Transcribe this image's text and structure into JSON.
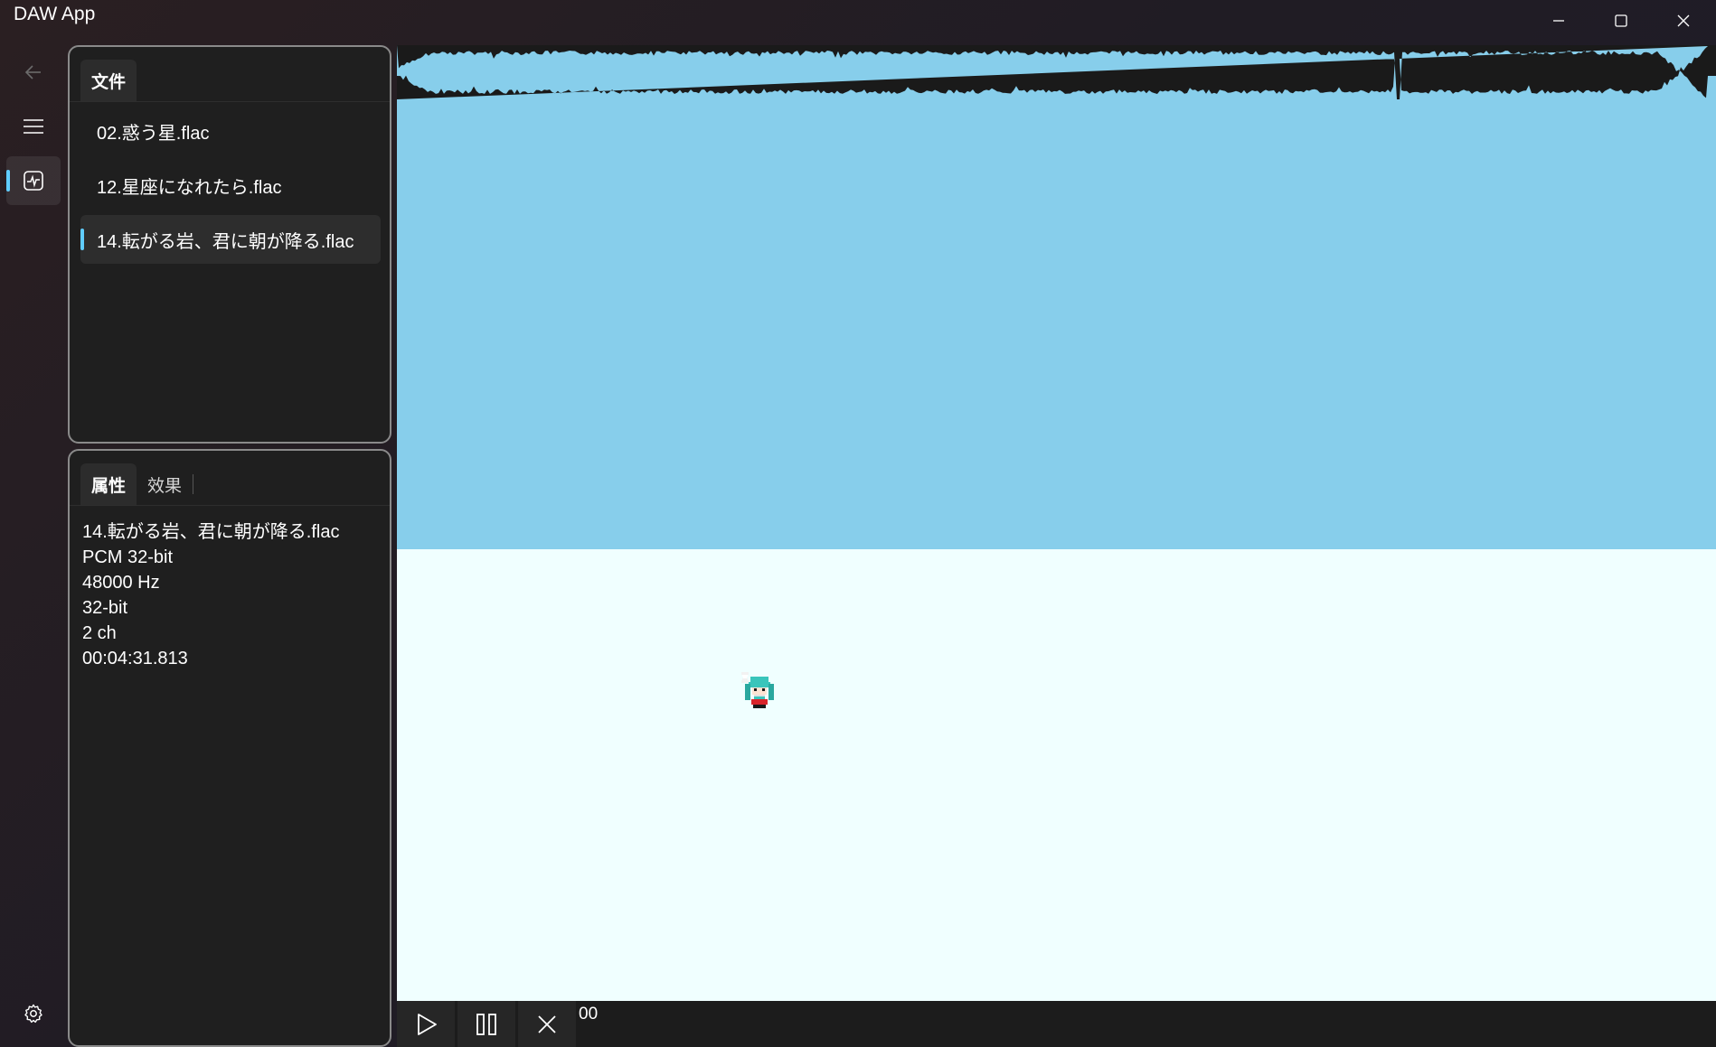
{
  "app": {
    "title": "DAW App"
  },
  "colors": {
    "accent": "#60cdff",
    "waveform_fill": "#87ceeb",
    "waveform_peak": "#1a1a1a",
    "canvas_bg": "#f0ffff"
  },
  "nav": {
    "items": [
      {
        "name": "back-icon",
        "selected": false
      },
      {
        "name": "menu-icon",
        "selected": false
      },
      {
        "name": "waveform-page-icon",
        "selected": true
      }
    ],
    "footer": {
      "name": "settings-icon"
    }
  },
  "files_panel": {
    "tab_label": "文件",
    "items": [
      {
        "label": "02.惑う星.flac",
        "selected": false
      },
      {
        "label": "12.星座になれたら.flac",
        "selected": false
      },
      {
        "label": "14.転がる岩、君に朝が降る.flac",
        "selected": true
      }
    ]
  },
  "props_panel": {
    "tabs": [
      {
        "label": "属性",
        "active": true
      },
      {
        "label": "效果",
        "active": false
      }
    ],
    "properties": {
      "filename": "14.転がる岩、君に朝が降る.flac",
      "format": "PCM 32-bit",
      "sample_rate": "48000 Hz",
      "bit_depth": "32-bit",
      "channels": "2 ch",
      "duration": "00:04:31.813"
    }
  },
  "transport": {
    "time": "00",
    "buttons": [
      "play-icon",
      "pause-icon",
      "stop-icon"
    ]
  }
}
